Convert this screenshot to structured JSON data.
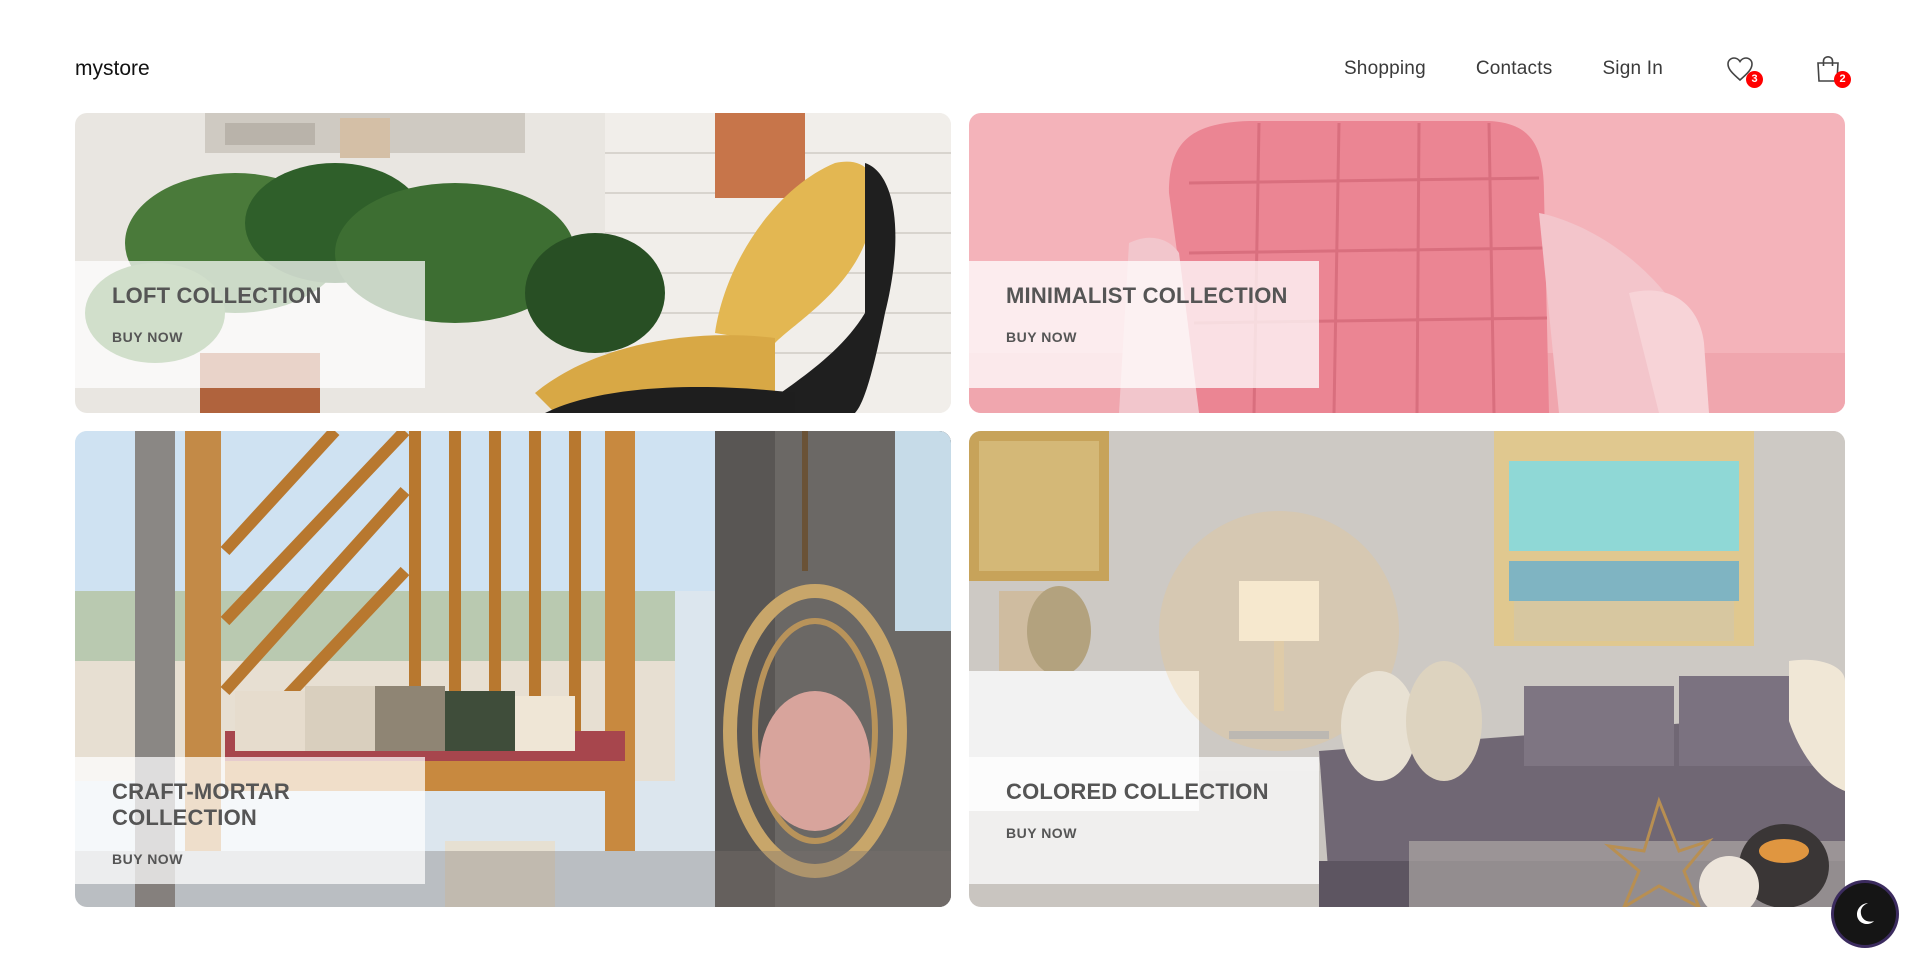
{
  "header": {
    "logo": "mystore",
    "nav": [
      "Shopping",
      "Contacts",
      "Sign In"
    ],
    "wishlist_icon": "heart-icon",
    "wishlist_count": "3",
    "cart_icon": "shopping-bag-icon",
    "cart_count": "2",
    "badge_color": "#ff0000"
  },
  "collections": [
    {
      "title": "LOFT COLLECTION",
      "cta": "BUY NOW"
    },
    {
      "title": "MINIMALIST COLLECTION",
      "cta": "BUY NOW"
    },
    {
      "title": "CRAFT-MORTAR COLLECTION",
      "cta": "BUY NOW"
    },
    {
      "title": "COLORED COLLECTION",
      "cta": "BUY NOW"
    }
  ],
  "theme_toggle": {
    "icon": "moon-icon"
  }
}
